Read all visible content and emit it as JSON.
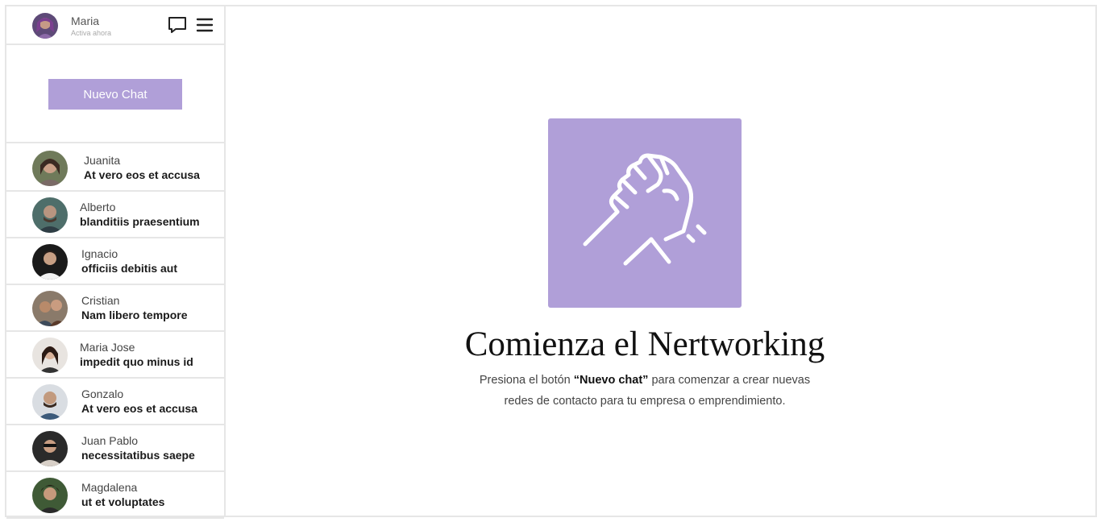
{
  "user": {
    "name": "Maria",
    "status": "Activa ahora"
  },
  "new_chat_button": "Nuevo Chat",
  "chats": [
    {
      "name": "Juanita",
      "message": "At vero eos et accusa"
    },
    {
      "name": "Alberto",
      "message": "blanditiis praesentium"
    },
    {
      "name": "Ignacio",
      "message": "officiis debitis aut"
    },
    {
      "name": "Cristian",
      "message": "Nam libero tempore"
    },
    {
      "name": "Maria Jose",
      "message": "impedit quo minus id"
    },
    {
      "name": "Gonzalo",
      "message": "At vero eos et accusa"
    },
    {
      "name": "Juan Pablo",
      "message": "necessitatibus saepe"
    },
    {
      "name": "Magdalena",
      "message": "ut et voluptates"
    }
  ],
  "main": {
    "title": "Comienza el Nertworking",
    "desc_pre": "Presiona el botón ",
    "desc_bold": "“Nuevo chat”",
    "desc_post": " para comenzar a crear nuevas",
    "desc_line2": "redes de contacto para tu empresa o emprendimiento."
  },
  "colors": {
    "accent": "#b09fd8",
    "border": "#e6e6e6"
  },
  "icons": {
    "chat": "chat-bubble-icon",
    "menu": "hamburger-menu-icon",
    "hero": "handshake-icon"
  }
}
